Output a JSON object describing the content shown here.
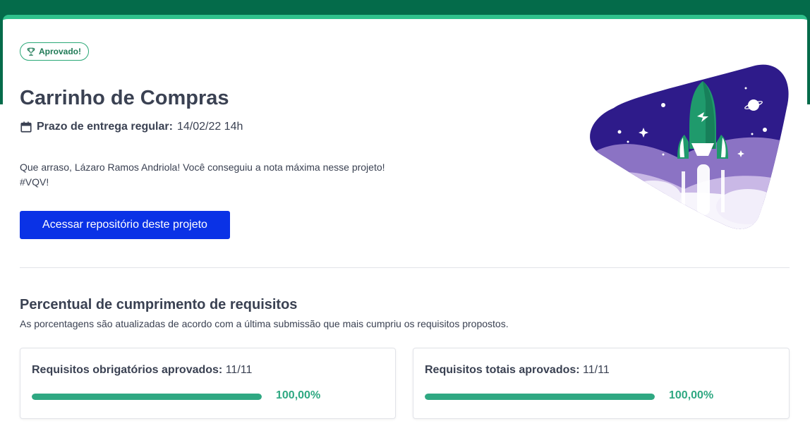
{
  "header": {
    "badge_label": "Aprovado!",
    "badge_icon": "trophy-icon",
    "title": "Carrinho de Compras",
    "deadline_label": "Prazo de entrega regular:",
    "deadline_value": "14/02/22 14h",
    "deadline_icon": "calendar-icon"
  },
  "message": {
    "line1": "Que arraso, Lázaro Ramos Andriola! Você conseguiu a nota máxima nesse projeto!",
    "line2": "#VQV!"
  },
  "repo_button_label": "Acessar repositório deste projeto",
  "requirements": {
    "title": "Percentual de cumprimento de requisitos",
    "subtitle": "As porcentagens são atualizadas de acordo com a última submissão que mais cumpriu os requisitos propostos.",
    "cards": [
      {
        "label": "Requisitos obrigatórios aprovados:",
        "count": "11/11",
        "percent_text": "100,00%",
        "percent": 100
      },
      {
        "label": "Requisitos totais aprovados:",
        "count": "11/11",
        "percent_text": "100,00%",
        "percent": 100
      }
    ]
  },
  "colors": {
    "header_bg": "#046b4a",
    "accent": "#2fc18c",
    "progress": "#2fa882",
    "button": "#0a32e6"
  }
}
